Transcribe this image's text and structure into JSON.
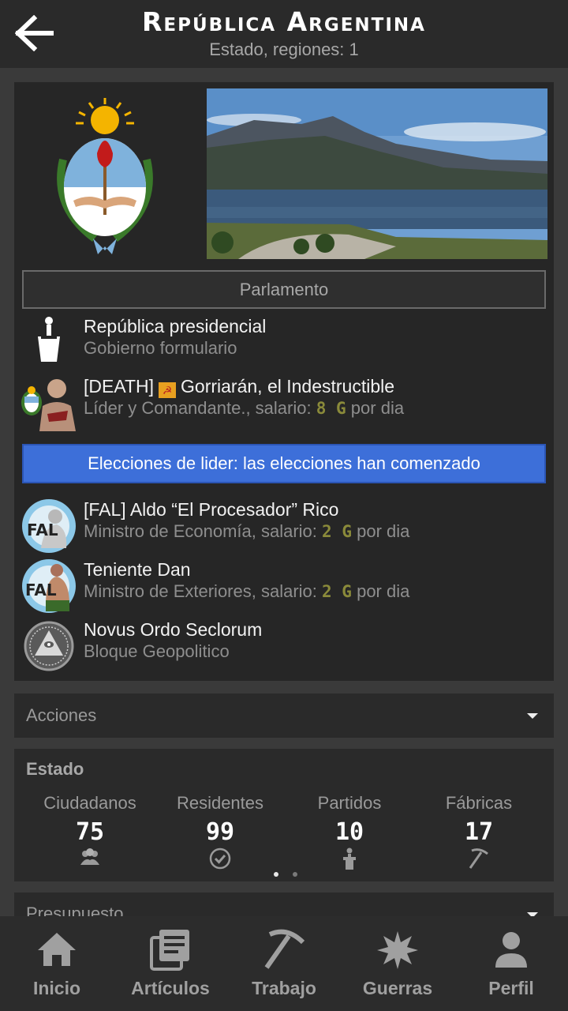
{
  "header": {
    "title": "República Argentina",
    "subtitle": "Estado, regiones: 1",
    "back_icon": "arrow-left-icon"
  },
  "main": {
    "parliament_button": "Parlamento",
    "government": {
      "title": "República presidencial",
      "subtitle": "Gobierno formulario"
    },
    "leader": {
      "name_prefix": "[DEATH]",
      "name": "Gorriarán, el Indestructible",
      "role": "Líder y Comandante., salario:",
      "salary": "8 G",
      "per": "por dia"
    },
    "elections_banner": "Elecciones de lider: las elecciones han comenzado",
    "ministers": [
      {
        "name": "[FAL] Aldo “El Procesador” Rico",
        "role": "Ministro de Economía, salario:",
        "salary": "2 G",
        "per": "por dia"
      },
      {
        "name": "Teniente Dan",
        "role": "Ministro de Exteriores, salario:",
        "salary": "2 G",
        "per": "por dia"
      }
    ],
    "bloc": {
      "name": "Novus Ordo Seclorum",
      "subtitle": "Bloque Geopolitico"
    }
  },
  "acciones": {
    "label": "Acciones"
  },
  "estado": {
    "title": "Estado",
    "stats": [
      {
        "label": "Ciudadanos",
        "value": "75",
        "icon": "people-icon"
      },
      {
        "label": "Residentes",
        "value": "99",
        "icon": "check-circle-icon"
      },
      {
        "label": "Partidos",
        "value": "10",
        "icon": "person-podium-icon"
      },
      {
        "label": "Fábricas",
        "value": "17",
        "icon": "pickaxe-icon"
      }
    ],
    "page_indicator": {
      "pages": 2,
      "active": 1
    }
  },
  "presupuesto": {
    "label": "Presupuesto"
  },
  "nav": [
    {
      "label": "Inicio",
      "icon": "home-icon"
    },
    {
      "label": "Artículos",
      "icon": "articles-icon"
    },
    {
      "label": "Trabajo",
      "icon": "pickaxe-icon"
    },
    {
      "label": "Guerras",
      "icon": "explosion-icon"
    },
    {
      "label": "Perfil",
      "icon": "person-icon"
    }
  ],
  "colors": {
    "header_bg": "#2a2a2a",
    "card_bg": "#262626",
    "elections_blue": "#3d6fd9",
    "salary_gold": "#8a8a3a"
  }
}
